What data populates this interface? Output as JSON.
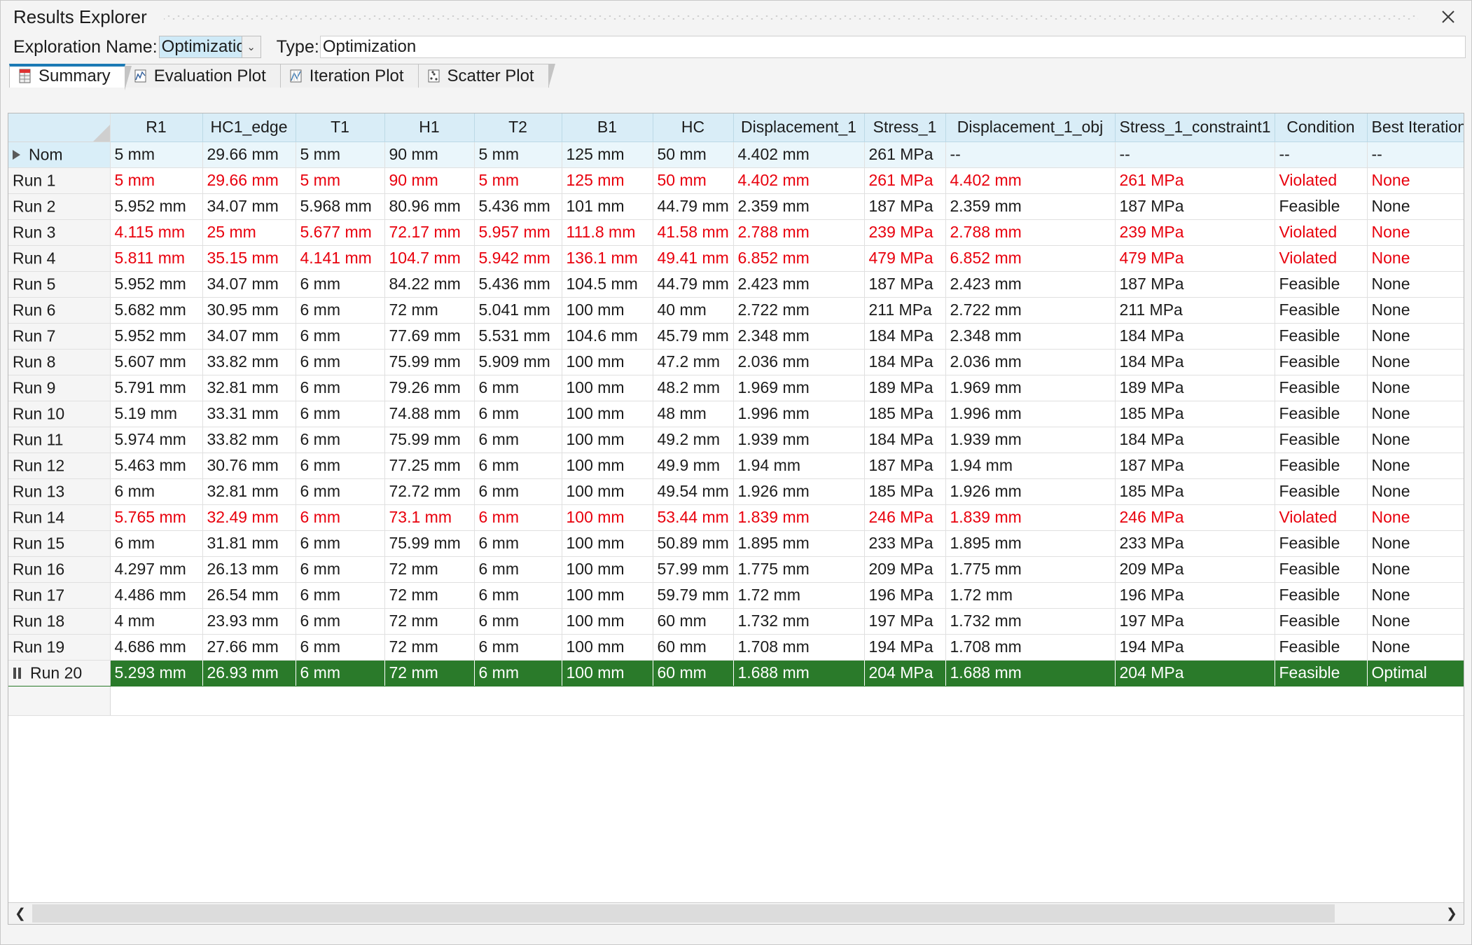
{
  "window": {
    "title": "Results Explorer",
    "close_label": "✕"
  },
  "toolbar": {
    "exploration_name_label": "Exploration Name:",
    "exploration_name_value": "Optimization",
    "dropdown_arrow": "⌄",
    "type_label": "Type:",
    "type_value": "Optimization"
  },
  "tabs": [
    {
      "label": "Summary",
      "icon": "summary-grid-icon",
      "active": true
    },
    {
      "label": "Evaluation Plot",
      "icon": "evaluation-plot-icon",
      "active": false
    },
    {
      "label": "Iteration Plot",
      "icon": "iteration-plot-icon",
      "active": false
    },
    {
      "label": "Scatter Plot",
      "icon": "scatter-plot-icon",
      "active": false
    }
  ],
  "colors": {
    "header_bg": "#d9edf7",
    "violated_text": "#e8000d",
    "optimal_bg": "#2a7a2a",
    "accent": "#1b7ab5"
  },
  "table": {
    "columns": [
      "",
      "R1",
      "HC1_edge",
      "T1",
      "H1",
      "T2",
      "B1",
      "HC",
      "Displacement_1",
      "Stress_1",
      "Displacement_1_obj",
      "Stress_1_constraint1",
      "Condition",
      "Best Iteration"
    ],
    "rows": [
      {
        "label": "Nom",
        "state": "nominal",
        "icon": "expander-triangle-icon",
        "cells": [
          "5 mm",
          "29.66 mm",
          "5 mm",
          "90 mm",
          "5 mm",
          "125 mm",
          "50 mm",
          "4.402 mm",
          "261 MPa",
          "--",
          "--",
          "--",
          "--"
        ],
        "bold": [
          false,
          false,
          false,
          false,
          false,
          false,
          false,
          false,
          false,
          false,
          false,
          false,
          false
        ]
      },
      {
        "label": "Run 1",
        "state": "violated",
        "icon": "",
        "cells": [
          "5 mm",
          "29.66 mm",
          "5 mm",
          "90 mm",
          "5 mm",
          "125 mm",
          "50 mm",
          "4.402 mm",
          "261 MPa",
          "4.402 mm",
          "261 MPa",
          "Violated",
          "None"
        ],
        "bold": [
          false,
          false,
          false,
          false,
          false,
          false,
          false,
          false,
          false,
          false,
          true,
          false,
          false
        ]
      },
      {
        "label": "Run 2",
        "state": "feasible",
        "icon": "",
        "cells": [
          "5.952 mm",
          "34.07 mm",
          "5.968 mm",
          "80.96 mm",
          "5.436 mm",
          "101 mm",
          "44.79 mm",
          "2.359 mm",
          "187 MPa",
          "2.359 mm",
          "187 MPa",
          "Feasible",
          "None"
        ],
        "bold": [
          true,
          false,
          true,
          false,
          false,
          true,
          false,
          false,
          false,
          false,
          false,
          false,
          false
        ]
      },
      {
        "label": "Run 3",
        "state": "violated",
        "icon": "",
        "cells": [
          "4.115 mm",
          "25 mm",
          "5.677 mm",
          "72.17 mm",
          "5.957 mm",
          "111.8 mm",
          "41.58 mm",
          "2.788 mm",
          "239 MPa",
          "2.788 mm",
          "239 MPa",
          "Violated",
          "None"
        ],
        "bold": [
          false,
          false,
          false,
          true,
          true,
          false,
          false,
          false,
          false,
          false,
          true,
          false,
          false
        ]
      },
      {
        "label": "Run 4",
        "state": "violated",
        "icon": "",
        "cells": [
          "5.811 mm",
          "35.15 mm",
          "4.141 mm",
          "104.7 mm",
          "5.942 mm",
          "136.1 mm",
          "49.41 mm",
          "6.852 mm",
          "479 MPa",
          "6.852 mm",
          "479 MPa",
          "Violated",
          "None"
        ],
        "bold": [
          false,
          true,
          false,
          false,
          true,
          false,
          false,
          false,
          false,
          false,
          true,
          false,
          false
        ]
      },
      {
        "label": "Run 5",
        "state": "feasible",
        "icon": "",
        "cells": [
          "5.952 mm",
          "34.07 mm",
          "6 mm",
          "84.22 mm",
          "5.436 mm",
          "104.5 mm",
          "44.79 mm",
          "2.423 mm",
          "187 MPa",
          "2.423 mm",
          "187 MPa",
          "Feasible",
          "None"
        ],
        "bold": [
          true,
          false,
          true,
          false,
          false,
          false,
          false,
          false,
          false,
          false,
          false,
          false,
          false
        ]
      },
      {
        "label": "Run 6",
        "state": "feasible",
        "icon": "",
        "cells": [
          "5.682 mm",
          "30.95 mm",
          "6 mm",
          "72 mm",
          "5.041 mm",
          "100 mm",
          "40 mm",
          "2.722 mm",
          "211 MPa",
          "2.722 mm",
          "211 MPa",
          "Feasible",
          "None"
        ],
        "bold": [
          false,
          false,
          true,
          true,
          false,
          true,
          true,
          false,
          false,
          false,
          false,
          false,
          false
        ]
      },
      {
        "label": "Run 7",
        "state": "feasible",
        "icon": "",
        "cells": [
          "5.952 mm",
          "34.07 mm",
          "6 mm",
          "77.69 mm",
          "5.531 mm",
          "104.6 mm",
          "45.79 mm",
          "2.348 mm",
          "184 MPa",
          "2.348 mm",
          "184 MPa",
          "Feasible",
          "None"
        ],
        "bold": [
          true,
          false,
          true,
          false,
          false,
          false,
          false,
          false,
          false,
          false,
          false,
          false,
          false
        ]
      },
      {
        "label": "Run 8",
        "state": "feasible",
        "icon": "",
        "cells": [
          "5.607 mm",
          "33.82 mm",
          "6 mm",
          "75.99 mm",
          "5.909 mm",
          "100 mm",
          "47.2 mm",
          "2.036 mm",
          "184 MPa",
          "2.036 mm",
          "184 MPa",
          "Feasible",
          "None"
        ],
        "bold": [
          false,
          false,
          true,
          false,
          true,
          true,
          false,
          false,
          false,
          false,
          false,
          false,
          false
        ]
      },
      {
        "label": "Run 9",
        "state": "feasible",
        "icon": "",
        "cells": [
          "5.791 mm",
          "32.81 mm",
          "6 mm",
          "79.26 mm",
          "6 mm",
          "100 mm",
          "48.2 mm",
          "1.969 mm",
          "189 MPa",
          "1.969 mm",
          "189 MPa",
          "Feasible",
          "None"
        ],
        "bold": [
          false,
          false,
          true,
          false,
          true,
          true,
          false,
          false,
          false,
          false,
          false,
          false,
          false
        ]
      },
      {
        "label": "Run 10",
        "state": "feasible",
        "icon": "",
        "cells": [
          "5.19 mm",
          "33.31 mm",
          "6 mm",
          "74.88 mm",
          "6 mm",
          "100 mm",
          "48 mm",
          "1.996 mm",
          "185 MPa",
          "1.996 mm",
          "185 MPa",
          "Feasible",
          "None"
        ],
        "bold": [
          false,
          false,
          true,
          false,
          true,
          true,
          false,
          false,
          false,
          false,
          false,
          false,
          false
        ]
      },
      {
        "label": "Run 11",
        "state": "feasible",
        "icon": "",
        "cells": [
          "5.974 mm",
          "33.82 mm",
          "6 mm",
          "75.99 mm",
          "6 mm",
          "100 mm",
          "49.2 mm",
          "1.939 mm",
          "184 MPa",
          "1.939 mm",
          "184 MPa",
          "Feasible",
          "None"
        ],
        "bold": [
          true,
          false,
          true,
          false,
          true,
          true,
          false,
          false,
          false,
          false,
          false,
          false,
          false
        ]
      },
      {
        "label": "Run 12",
        "state": "feasible",
        "icon": "",
        "cells": [
          "5.463 mm",
          "30.76 mm",
          "6 mm",
          "77.25 mm",
          "6 mm",
          "100 mm",
          "49.9 mm",
          "1.94 mm",
          "187 MPa",
          "1.94 mm",
          "187 MPa",
          "Feasible",
          "None"
        ],
        "bold": [
          false,
          false,
          true,
          false,
          true,
          true,
          false,
          false,
          false,
          false,
          false,
          false,
          false
        ]
      },
      {
        "label": "Run 13",
        "state": "feasible",
        "icon": "",
        "cells": [
          "6 mm",
          "32.81 mm",
          "6 mm",
          "72.72 mm",
          "6 mm",
          "100 mm",
          "49.54 mm",
          "1.926 mm",
          "185 MPa",
          "1.926 mm",
          "185 MPa",
          "Feasible",
          "None"
        ],
        "bold": [
          true,
          false,
          true,
          true,
          true,
          true,
          false,
          false,
          false,
          false,
          false,
          false,
          false
        ]
      },
      {
        "label": "Run 14",
        "state": "violated",
        "icon": "",
        "cells": [
          "5.765 mm",
          "32.49 mm",
          "6 mm",
          "73.1 mm",
          "6 mm",
          "100 mm",
          "53.44 mm",
          "1.839 mm",
          "246 MPa",
          "1.839 mm",
          "246 MPa",
          "Violated",
          "None"
        ],
        "bold": [
          false,
          false,
          true,
          true,
          true,
          true,
          false,
          false,
          false,
          false,
          true,
          false,
          false
        ]
      },
      {
        "label": "Run 15",
        "state": "feasible",
        "icon": "",
        "cells": [
          "6 mm",
          "31.81 mm",
          "6 mm",
          "75.99 mm",
          "6 mm",
          "100 mm",
          "50.89 mm",
          "1.895 mm",
          "233 MPa",
          "1.895 mm",
          "233 MPa",
          "Feasible",
          "None"
        ],
        "bold": [
          true,
          false,
          true,
          false,
          true,
          true,
          false,
          false,
          false,
          false,
          false,
          false,
          false
        ]
      },
      {
        "label": "Run 16",
        "state": "feasible",
        "icon": "",
        "cells": [
          "4.297 mm",
          "26.13 mm",
          "6 mm",
          "72 mm",
          "6 mm",
          "100 mm",
          "57.99 mm",
          "1.775 mm",
          "209 MPa",
          "1.775 mm",
          "209 MPa",
          "Feasible",
          "None"
        ],
        "bold": [
          false,
          false,
          true,
          true,
          true,
          true,
          false,
          false,
          false,
          false,
          false,
          false,
          false
        ]
      },
      {
        "label": "Run 17",
        "state": "feasible",
        "icon": "",
        "cells": [
          "4.486 mm",
          "26.54 mm",
          "6 mm",
          "72 mm",
          "6 mm",
          "100 mm",
          "59.79 mm",
          "1.72 mm",
          "196 MPa",
          "1.72 mm",
          "196 MPa",
          "Feasible",
          "None"
        ],
        "bold": [
          false,
          false,
          true,
          true,
          true,
          true,
          true,
          false,
          false,
          false,
          false,
          false,
          false
        ]
      },
      {
        "label": "Run 18",
        "state": "feasible",
        "icon": "",
        "cells": [
          "4 mm",
          "23.93 mm",
          "6 mm",
          "72 mm",
          "6 mm",
          "100 mm",
          "60 mm",
          "1.732 mm",
          "197 MPa",
          "1.732 mm",
          "197 MPa",
          "Feasible",
          "None"
        ],
        "bold": [
          true,
          true,
          true,
          true,
          true,
          true,
          true,
          false,
          false,
          false,
          false,
          false,
          false
        ]
      },
      {
        "label": "Run 19",
        "state": "feasible",
        "icon": "",
        "cells": [
          "4.686 mm",
          "27.66 mm",
          "6 mm",
          "72 mm",
          "6 mm",
          "100 mm",
          "60 mm",
          "1.708 mm",
          "194 MPa",
          "1.708 mm",
          "194 MPa",
          "Feasible",
          "None"
        ],
        "bold": [
          false,
          false,
          true,
          true,
          true,
          true,
          true,
          false,
          false,
          false,
          false,
          false,
          false
        ]
      },
      {
        "label": "Run 20",
        "state": "optimal",
        "icon": "pause-icon",
        "cells": [
          "5.293 mm",
          "26.93 mm",
          "6 mm",
          "72 mm",
          "6 mm",
          "100 mm",
          "60 mm",
          "1.688 mm",
          "204 MPa",
          "1.688 mm",
          "204 MPa",
          "Feasible",
          "Optimal"
        ],
        "bold": [
          false,
          false,
          false,
          false,
          false,
          false,
          false,
          false,
          false,
          false,
          false,
          false,
          false
        ]
      }
    ]
  },
  "scrollbar": {
    "left_arrow": "❮",
    "right_arrow": "❯"
  }
}
